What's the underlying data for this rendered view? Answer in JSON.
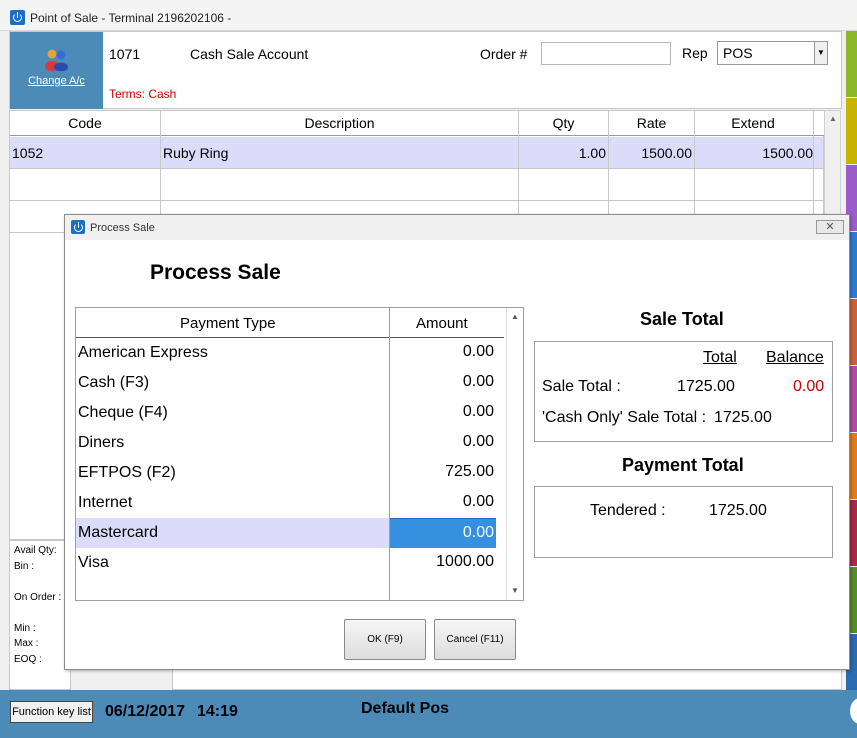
{
  "window": {
    "title": "Point of Sale - Terminal 2196202106     -"
  },
  "header": {
    "change_account_label": "Change A/c",
    "account_code": "1071",
    "account_name": "Cash Sale Account",
    "order_label": "Order #",
    "order_value": "",
    "rep_label": "Rep",
    "rep_value": "POS",
    "terms": "Terms: Cash"
  },
  "grid": {
    "columns": [
      "Code",
      "Description",
      "Qty",
      "Rate",
      "Extend"
    ],
    "rows": [
      {
        "code": "1052",
        "description": "Ruby Ring",
        "qty": "1.00",
        "rate": "1500.00",
        "extend": "1500.00"
      }
    ]
  },
  "info_panel": {
    "avail_qty": "Avail Qty:",
    "bin": "Bin :",
    "on_order": "On Order :",
    "min": "Min :",
    "max": "Max :",
    "eoq": "EOQ :"
  },
  "statusbar": {
    "function_key_list": "Function key list",
    "date": "06/12/2017",
    "time": "14:19",
    "pos_name": "Default Pos"
  },
  "dialog": {
    "title": "Process Sale",
    "heading": "Process Sale",
    "payment_table": {
      "col_type": "Payment Type",
      "col_amount": "Amount",
      "rows": [
        {
          "type": "American Express",
          "amount": "0.00"
        },
        {
          "type": "Cash (F3)",
          "amount": "0.00"
        },
        {
          "type": "Cheque (F4)",
          "amount": "0.00"
        },
        {
          "type": "Diners",
          "amount": "0.00"
        },
        {
          "type": "EFTPOS (F2)",
          "amount": "725.00"
        },
        {
          "type": "Internet",
          "amount": "0.00"
        },
        {
          "type": "Mastercard",
          "amount": "0.00"
        },
        {
          "type": "Visa",
          "amount": "1000.00"
        }
      ]
    },
    "sale_total": {
      "title": "Sale Total",
      "col_total": "Total",
      "col_balance": "Balance",
      "label": "Sale Total :",
      "total": "1725.00",
      "balance": "0.00",
      "cash_only_label": "'Cash Only' Sale Total :",
      "cash_only_value": "1725.00"
    },
    "payment_total": {
      "title": "Payment Total",
      "tendered_label": "Tendered :",
      "tendered_value": "1725.00"
    },
    "ok_label": "OK (F9)",
    "cancel_label": "Cancel (F11)"
  },
  "colors": {
    "accent": "#4c8ab8",
    "balance": "#cc0000",
    "selected_row": "#dcdcfa",
    "selected_cell": "#3591e0",
    "side_bar": [
      "#8ab82a",
      "#c8b400",
      "#9b5bc9",
      "#2f7ad0",
      "#c8623a",
      "#b04aa8",
      "#e07a20",
      "#a82848",
      "#5a8a2a",
      "#2a6ab0"
    ]
  }
}
